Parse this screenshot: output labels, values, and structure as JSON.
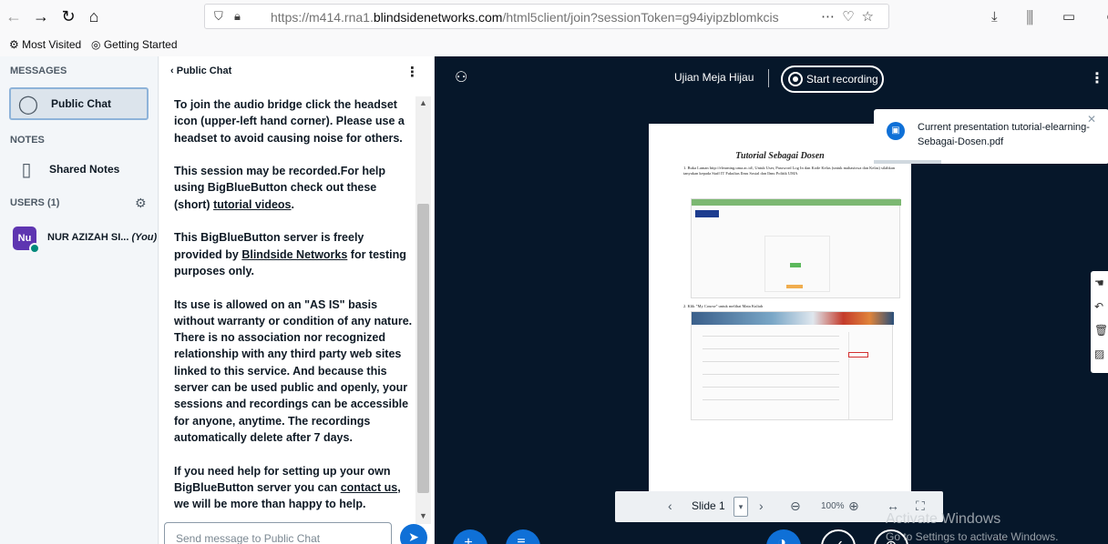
{
  "browser": {
    "url_prefix": "https://m414.rna1.",
    "url_domain": "blindsidenetworks.com",
    "url_suffix": "/html5client/join?sessionToken=g94iyipzblomkcis",
    "bookmarks": [
      "Most Visited",
      "Getting Started"
    ]
  },
  "sidebar": {
    "messages_title": "MESSAGES",
    "public_chat_label": "Public Chat",
    "notes_title": "NOTES",
    "shared_notes_label": "Shared Notes",
    "users_title": "USERS (1)",
    "user": {
      "initials": "Nu",
      "name": "NUR AZIZAH SI...",
      "you_tag": "(You)"
    }
  },
  "chat": {
    "header": "Public Chat",
    "p1": "To join the audio bridge click the headset icon (upper-left hand corner). Please use a headset to avoid causing noise for others.",
    "p2_a": "This session may be recorded.For help using BigBlueButton check out these (short) ",
    "p2_link": "tutorial videos",
    "p2_b": ".",
    "p3_a": "This BigBlueButton server is freely provided by ",
    "p3_link": "Blindside Networks",
    "p3_b": " for testing purposes only.",
    "p4": "Its use is allowed on an \"AS IS\" basis without warranty or condition of any nature. There is no association nor recognized relationship with any third party web sites linked to this service. And because this server can be used public and openly, your sessions and recordings can be accessible for anyone, anytime. The recordings automatically delete after 7 days.",
    "p5_a": "If you need help for setting up your own BigBlueButton server you can ",
    "p5_link": "contact us",
    "p5_b": ", we will be more than happy to help.",
    "input_placeholder": "Send message to Public Chat"
  },
  "presentation": {
    "meeting_title": "Ujian Meja Hijau",
    "record_label": "Start recording",
    "slide_title": "Tutorial Sebagai Dosen",
    "slide_step1": "1.  Buka Laman http://elearning.uma.ac.id/, Untuk User, Password Log In dan Kode Kelas (untuk mahasiswa dan Kelas) silahkan tanyakan kepada Staff IT Fakultas Ilmu Sosial dan Ilmu Politik UMA",
    "slide_step2": "2.  Klik \"My Course\" untuk melihat Mata Kuliah",
    "toast_text": "Current presentation tutorial-elearning-Sebagai-Dosen.pdf",
    "slide_label": "Slide 1",
    "zoom": "100%"
  },
  "watermark": {
    "line1": "Activate Windows",
    "line2": "Go to Settings to activate Windows."
  }
}
